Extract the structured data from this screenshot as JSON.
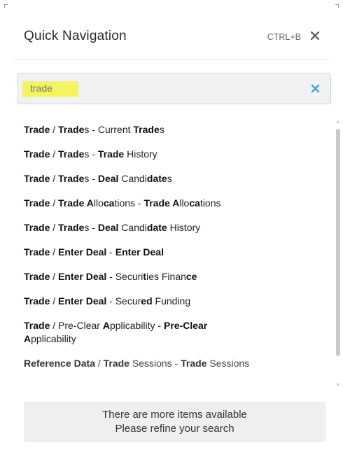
{
  "header": {
    "title": "Quick Navigation",
    "shortcut": "CTRL+B"
  },
  "search": {
    "value": "trade"
  },
  "results": [
    [
      {
        "t": "Trade",
        "b": true
      },
      {
        "t": " / ",
        "b": false
      },
      {
        "t": "Trade",
        "b": true
      },
      {
        "t": "s - Current ",
        "b": false
      },
      {
        "t": "Trade",
        "b": true
      },
      {
        "t": "s",
        "b": false
      }
    ],
    [
      {
        "t": "Trade",
        "b": true
      },
      {
        "t": " / ",
        "b": false
      },
      {
        "t": "Trade",
        "b": true
      },
      {
        "t": "s - ",
        "b": false
      },
      {
        "t": "Trade",
        "b": true
      },
      {
        "t": " History",
        "b": false
      }
    ],
    [
      {
        "t": "Trade",
        "b": true
      },
      {
        "t": " / ",
        "b": false
      },
      {
        "t": "Trade",
        "b": true
      },
      {
        "t": "s - ",
        "b": false
      },
      {
        "t": "Deal",
        "b": true
      },
      {
        "t": " Candi",
        "b": false
      },
      {
        "t": "date",
        "b": true
      },
      {
        "t": "s",
        "b": false
      }
    ],
    [
      {
        "t": "Trade",
        "b": true
      },
      {
        "t": " / ",
        "b": false
      },
      {
        "t": "Trade A",
        "b": true
      },
      {
        "t": "llo",
        "b": false
      },
      {
        "t": "ca",
        "b": true
      },
      {
        "t": "tions - ",
        "b": false
      },
      {
        "t": "Trade A",
        "b": true
      },
      {
        "t": "llo",
        "b": false
      },
      {
        "t": "ca",
        "b": true
      },
      {
        "t": "tions",
        "b": false
      }
    ],
    [
      {
        "t": "Trade",
        "b": true
      },
      {
        "t": " / ",
        "b": false
      },
      {
        "t": "Trade",
        "b": true
      },
      {
        "t": "s - ",
        "b": false
      },
      {
        "t": "Deal",
        "b": true
      },
      {
        "t": " Candi",
        "b": false
      },
      {
        "t": "date",
        "b": true
      },
      {
        "t": " History",
        "b": false
      }
    ],
    [
      {
        "t": "Trade",
        "b": true
      },
      {
        "t": " / ",
        "b": false
      },
      {
        "t": "Enter Deal",
        "b": true
      },
      {
        "t": " - ",
        "b": false
      },
      {
        "t": "Enter Deal",
        "b": true
      }
    ],
    [
      {
        "t": "Trade",
        "b": true
      },
      {
        "t": " / ",
        "b": false
      },
      {
        "t": "Enter Deal",
        "b": true
      },
      {
        "t": " - Securi",
        "b": false
      },
      {
        "t": "t",
        "b": true
      },
      {
        "t": "ies Finan",
        "b": false
      },
      {
        "t": "ce",
        "b": true
      }
    ],
    [
      {
        "t": "Trade",
        "b": true
      },
      {
        "t": " / ",
        "b": false
      },
      {
        "t": "Enter Deal",
        "b": true
      },
      {
        "t": " - Secur",
        "b": false
      },
      {
        "t": "ed",
        "b": true
      },
      {
        "t": " Funding",
        "b": false
      }
    ],
    [
      {
        "t": "Trade",
        "b": true
      },
      {
        "t": " / Pre-Clear ",
        "b": false
      },
      {
        "t": "A",
        "b": true
      },
      {
        "t": "pplicability - ",
        "b": false
      },
      {
        "t": "Pre-Clear A",
        "b": true
      },
      {
        "t": "pplicability",
        "b": false
      }
    ],
    [
      {
        "t": "Reference Data",
        "b": true
      },
      {
        "t": " / ",
        "b": false
      },
      {
        "t": "Trade",
        "b": true
      },
      {
        "t": " Sessions - ",
        "b": false
      },
      {
        "t": "Trade",
        "b": true
      },
      {
        "t": " Sessions",
        "b": false
      }
    ]
  ],
  "notice": {
    "line1": "There are more items available",
    "line2": "Please refine your search"
  },
  "colors": {
    "accent_clear": "#3aa3d8",
    "highlight": "#f4f43a"
  }
}
